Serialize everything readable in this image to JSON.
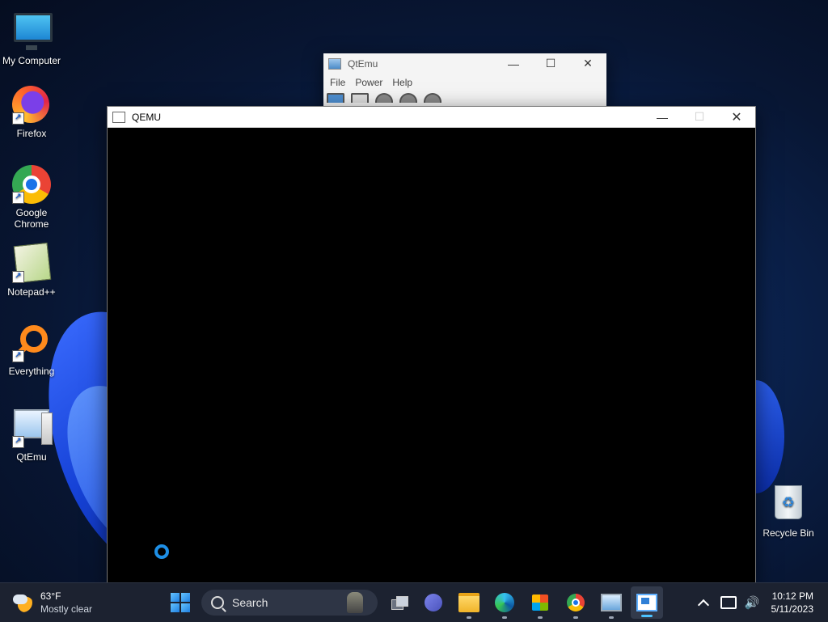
{
  "desktop": {
    "icons": [
      {
        "label": "My Computer",
        "icon": "monitor-icon"
      },
      {
        "label": "Firefox",
        "icon": "firefox-icon"
      },
      {
        "label": "Google Chrome",
        "icon": "chrome-icon"
      },
      {
        "label": "Notepad++",
        "icon": "notepad-plus-plus-icon"
      },
      {
        "label": "Everything",
        "icon": "everything-search-icon"
      },
      {
        "label": "QtEmu",
        "icon": "qtemu-icon"
      },
      {
        "label": "Recycle Bin",
        "icon": "recycle-bin-icon"
      }
    ],
    "shortcut_glyph": "↗"
  },
  "qtemu_window": {
    "title": "QtEmu",
    "menu": [
      "File",
      "Power",
      "Help"
    ],
    "controls": {
      "minimize": "—",
      "maximize": "☐",
      "close": "✕"
    }
  },
  "qemu_window": {
    "title": "QEMU",
    "controls": {
      "minimize": "—",
      "maximize": "☐",
      "close": "✕"
    },
    "screen_color": "#000000",
    "spinner_color": "#1e8fe6"
  },
  "taskbar": {
    "weather": {
      "temp": "63°F",
      "condition": "Mostly clear"
    },
    "search_label": "Search",
    "apps": [
      "task-view",
      "teams-meet",
      "file-explorer",
      "edge",
      "microsoft-store",
      "chrome",
      "qtemu",
      "qemu"
    ],
    "tray": {
      "time": "10:12 PM",
      "date": "5/11/2023",
      "volume_glyph": "🔊"
    }
  }
}
